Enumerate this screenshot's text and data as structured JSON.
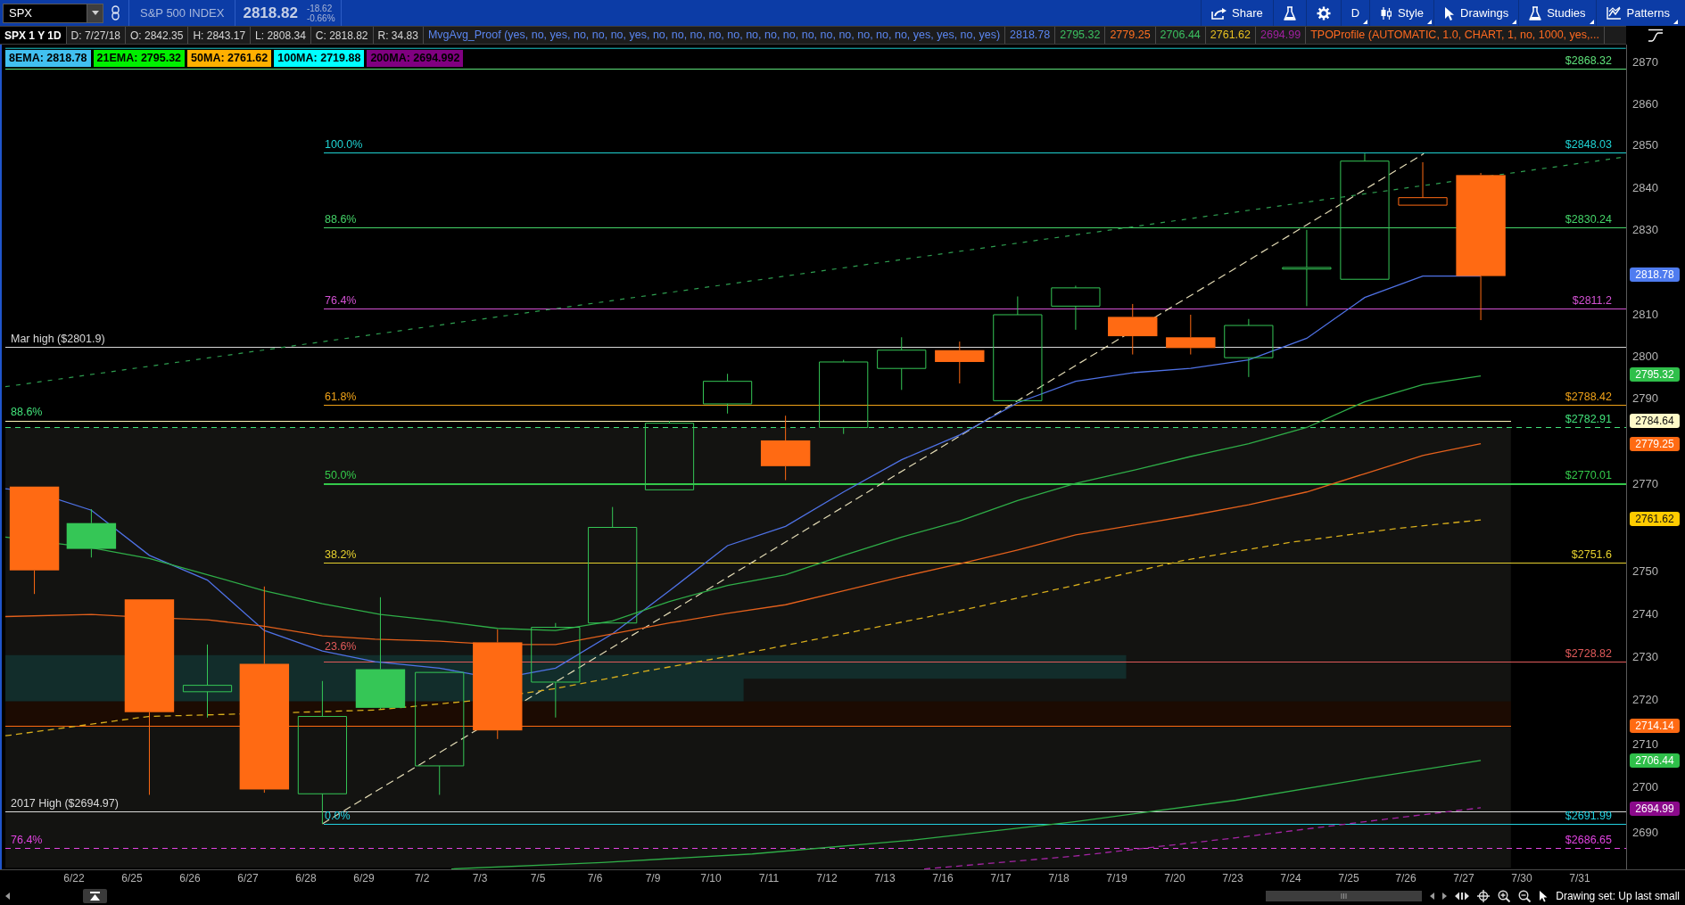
{
  "toolbar": {
    "symbol": "SPX",
    "description": "S&P 500 INDEX",
    "last_price": "2818.82",
    "change": "-18.62",
    "change_percent": "-0.66%",
    "buttons": [
      {
        "kind": "share",
        "label": "Share",
        "dropdown": false
      },
      {
        "kind": "flask",
        "dropdown": false
      },
      {
        "kind": "gear",
        "dropdown": false
      },
      {
        "kind": "text",
        "label": "D",
        "dropdown": true
      },
      {
        "kind": "style",
        "label": "Style",
        "dropdown": true
      },
      {
        "kind": "drawings",
        "label": "Drawings",
        "dropdown": true
      },
      {
        "kind": "studies",
        "label": "Studies",
        "dropdown": true
      },
      {
        "kind": "patterns",
        "label": "Patterns",
        "dropdown": true
      }
    ]
  },
  "info_bar": {
    "title": "SPX 1 Y 1D",
    "fields": [
      "D: 7/27/18",
      "O: 2842.35",
      "H: 2843.17",
      "L: 2808.34",
      "C: 2818.82",
      "R: 34.83"
    ],
    "studies": [
      {
        "text": "MvgAvg_Proof (yes, no, yes, no, no, no, yes, no, no, no, no, no, no, no, no, no, no, no, no, no, no, yes, yes, no, yes)",
        "color": "#5b86f0"
      },
      {
        "text": "2818.78",
        "color": "#5b86f0"
      },
      {
        "text": "2795.32",
        "color": "#3cc060"
      },
      {
        "text": "2779.25",
        "color": "#ff7020"
      },
      {
        "text": "2706.44",
        "color": "#3cc060"
      },
      {
        "text": "2761.62",
        "color": "#e8c020"
      },
      {
        "text": "2694.99",
        "color": "#a020a0"
      },
      {
        "text": "TPOProfile (AUTOMATIC, 1.0, CHART, 1, no, 1000, yes,...",
        "color": "#ff6a20"
      }
    ]
  },
  "chart": {
    "ma_legend": [
      {
        "label": "8EMA: 2818.78",
        "color": "#41c0f0"
      },
      {
        "label": "21EMA: 2795.32",
        "color": "#00f000"
      },
      {
        "label": "50MA: 2761.62",
        "color": "#ffb000"
      },
      {
        "label": "100MA: 2719.88",
        "color": "#00ffff"
      },
      {
        "label": "200MA: 2694.992",
        "color": "#800080"
      }
    ],
    "levels": [
      {
        "kind": "solid",
        "right_label": "$2868.32",
        "color": "#5ee27a"
      },
      {
        "kind": "solid",
        "left_label": "100.0%",
        "right_label": "$2848.03",
        "color": "#1fd3d3"
      },
      {
        "kind": "solid",
        "left_label": "88.6%",
        "right_label": "$2830.24",
        "color": "#44d468"
      },
      {
        "kind": "solid",
        "left_label": "76.4%",
        "right_label": "$2811.2",
        "color": "#d452d4"
      },
      {
        "kind": "solid",
        "left_label": "Mar high ($2801.9)",
        "color": "#d9d9d9"
      },
      {
        "kind": "solid",
        "left_label": "61.8%",
        "right_label": "$2788.42",
        "color": "#f0a218"
      },
      {
        "kind": "dashed",
        "left_label": "88.6%",
        "right_label": "$2782.91",
        "color": "#42e27a"
      },
      {
        "kind": "solid",
        "color": "#fff7b8"
      },
      {
        "kind": "solid",
        "left_label": "50.0%",
        "right_label": "$2770.01",
        "color": "#34c84a"
      },
      {
        "kind": "solid",
        "left_label": "38.2%",
        "right_label": "$2751.6",
        "color": "#e6d02e"
      },
      {
        "kind": "solid",
        "left_label": "23.6%",
        "right_label": "$2728.82",
        "color": "#e05a5a"
      },
      {
        "kind": "solid",
        "color": "#ff6a10"
      },
      {
        "kind": "solid",
        "left_label": "2017 High ($2694.97)",
        "color": "#d9d9d9"
      },
      {
        "kind": "solid",
        "left_label": "0.0%",
        "right_label": "$2691.99",
        "color": "#22d0e0"
      },
      {
        "kind": "dashed",
        "left_label": "76.4%",
        "right_label": "$2686.65",
        "color": "#e244e2"
      }
    ],
    "price_axis": {
      "ticks": [
        "2870",
        "2860",
        "2850",
        "2840",
        "2830",
        "2810",
        "2800",
        "2790",
        "2770",
        "2750",
        "2740",
        "2730",
        "2720",
        "2710",
        "2700",
        "2690"
      ],
      "tags": [
        {
          "text": "2818.78",
          "color": "#4f7cf0"
        },
        {
          "text": "2795.32",
          "color": "#2fbf4a"
        },
        {
          "text": "2784.64",
          "color": "#fffac8"
        },
        {
          "text": "2779.25",
          "color": "#ff6a13"
        },
        {
          "text": "2761.62",
          "color": "#ffcc00"
        },
        {
          "text": "2714.14",
          "color": "#ff6a13"
        },
        {
          "text": "2706.44",
          "color": "#2fbf4a"
        },
        {
          "text": "2694.99",
          "color": "#8b0a8b"
        }
      ]
    },
    "date_axis": [
      "6/22",
      "6/25",
      "6/26",
      "6/27",
      "6/28",
      "6/29",
      "7/2",
      "7/3",
      "7/5",
      "7/6",
      "7/9",
      "7/10",
      "7/11",
      "7/12",
      "7/13",
      "7/16",
      "7/17",
      "7/18",
      "7/19",
      "7/20",
      "7/23",
      "7/24",
      "7/25",
      "7/26",
      "7/27",
      "7/30",
      "7/31"
    ]
  },
  "status_bar": {
    "text": "Drawing set: Up last small"
  }
}
